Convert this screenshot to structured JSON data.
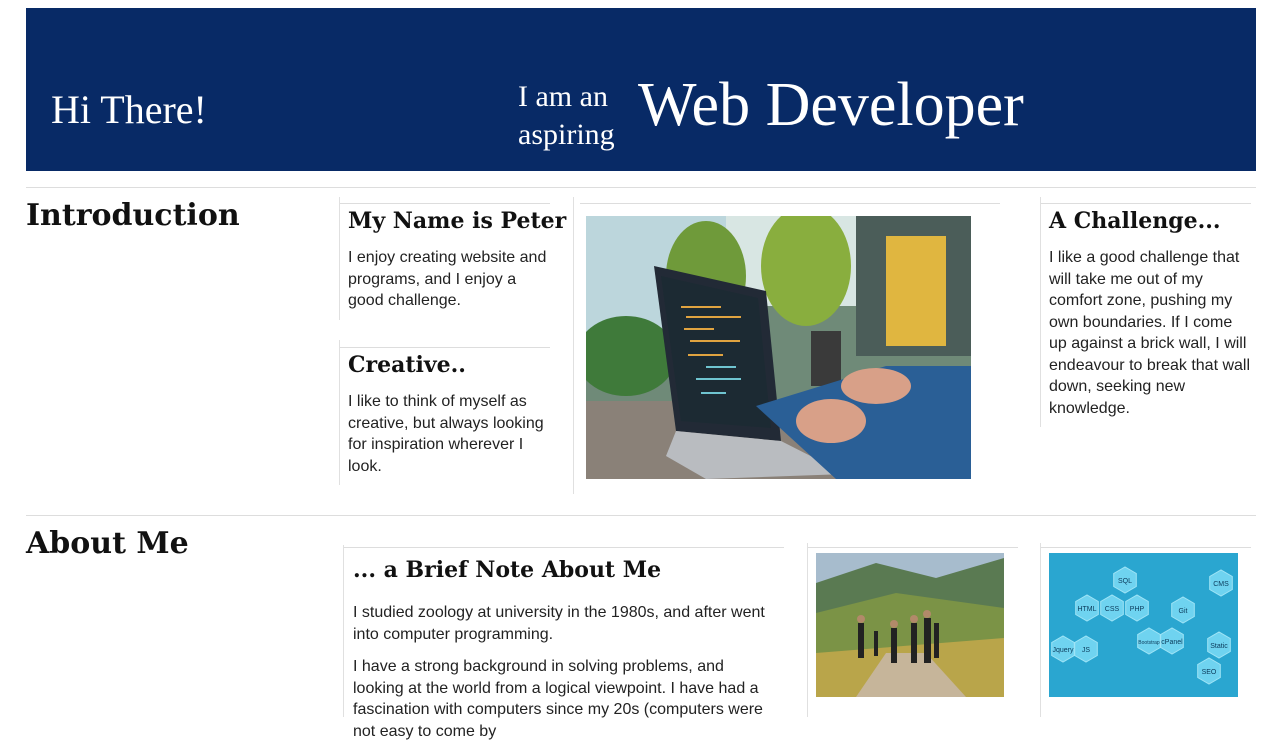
{
  "header": {
    "greeting": "Hi There!",
    "aspire_line1": "I am an",
    "aspire_line2": "aspiring",
    "role": "Web Developer"
  },
  "introduction": {
    "title": "Introduction",
    "name_card": {
      "title": "My Name is Peter",
      "text": "I enjoy creating website and programs, and I enjoy a good challenge."
    },
    "creative_card": {
      "title": "Creative..",
      "text": "I like to think of myself as creative, but always looking for inspiration wherever I look."
    },
    "challenge_card": {
      "title": "A Challenge...",
      "text": "I like a good challenge that will take me out of my comfort zone, pushing my own boundaries. If I come up against a brick wall, I will endeavour to break that wall down, seeking new knowledge."
    }
  },
  "about": {
    "title": "About Me",
    "note_title": "... a Brief Note About Me",
    "para1": "I studied zoology at university in the 1980s, and after went into computer programming.",
    "para2": "I have a strong background in solving problems, and looking at the world from a logical viewpoint. I have had a fascination with computers since my 20s (computers were not easy to come by"
  },
  "skills": [
    "SQL",
    "CMS",
    "HTML",
    "CSS",
    "PHP",
    "Git",
    "Bootstrap",
    "cPanel",
    "Static",
    "Jquery",
    "JS",
    "SEO"
  ],
  "colors": {
    "banner": "#082a66",
    "hex": "#6fd3f0",
    "skills_bg": "#2aa6d0"
  }
}
